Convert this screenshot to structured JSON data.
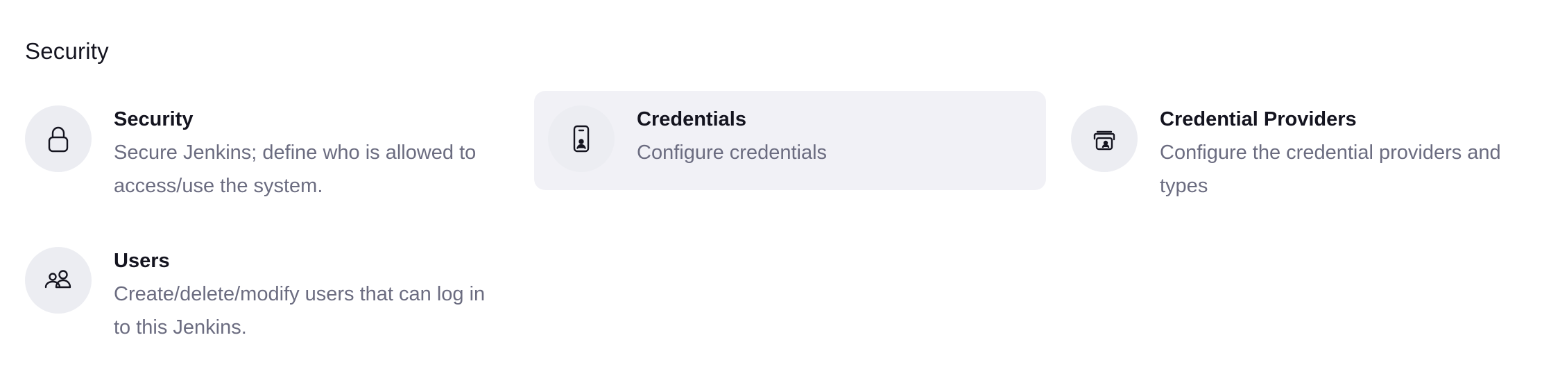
{
  "section": {
    "title": "Security"
  },
  "items": [
    {
      "title": "Security",
      "description": "Secure Jenkins; define who is allowed to access/use the system.",
      "icon": "lock-icon"
    },
    {
      "title": "Credentials",
      "description": "Configure credentials",
      "icon": "id-badge-icon"
    },
    {
      "title": "Credential Providers",
      "description": "Configure the credential providers and types",
      "icon": "credential-stack-icon"
    },
    {
      "title": "Users",
      "description": "Create/delete/modify users that can log in to this Jenkins.",
      "icon": "users-icon"
    }
  ]
}
